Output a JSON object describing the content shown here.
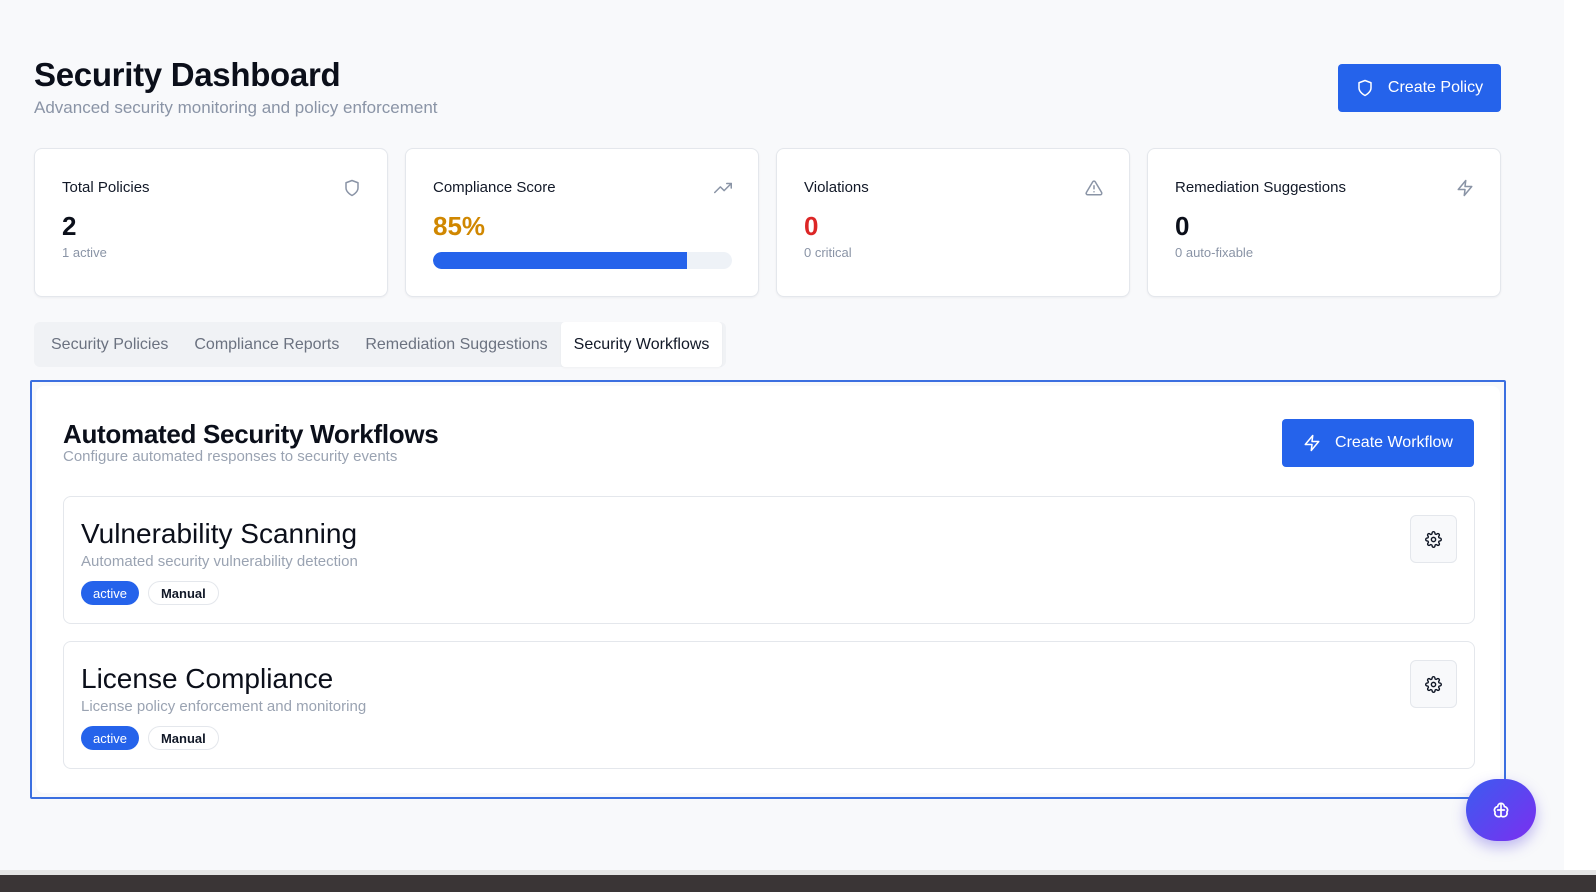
{
  "header": {
    "title": "Security Dashboard",
    "subtitle": "Advanced security monitoring and policy enforcement",
    "create_policy_label": "Create Policy"
  },
  "stats": [
    {
      "label": "Total Policies",
      "value": "2",
      "sub": "1 active",
      "icon": "shield-icon",
      "value_color": "#0b0f1a"
    },
    {
      "label": "Compliance Score",
      "value": "85%",
      "progress": 0.85,
      "icon": "trending-up-icon",
      "value_color": "#d08700"
    },
    {
      "label": "Violations",
      "value": "0",
      "sub": "0 critical",
      "icon": "alert-triangle-icon",
      "value_color": "#dc2626"
    },
    {
      "label": "Remediation Suggestions",
      "value": "0",
      "sub": "0 auto-fixable",
      "icon": "zap-icon",
      "value_color": "#0b0f1a"
    }
  ],
  "tabs": [
    {
      "label": "Security Policies",
      "active": false
    },
    {
      "label": "Compliance Reports",
      "active": false
    },
    {
      "label": "Remediation Suggestions",
      "active": false
    },
    {
      "label": "Security Workflows",
      "active": true
    }
  ],
  "panel": {
    "title": "Automated Security Workflows",
    "subtitle": "Configure automated responses to security events",
    "create_workflow_label": "Create Workflow"
  },
  "workflows": [
    {
      "name": "Vulnerability Scanning",
      "description": "Automated security vulnerability detection",
      "status": "active",
      "trigger": "Manual"
    },
    {
      "name": "License Compliance",
      "description": "License policy enforcement and monitoring",
      "status": "active",
      "trigger": "Manual"
    }
  ],
  "colors": {
    "accent": "#2563eb",
    "warning": "#d08700",
    "danger": "#dc2626",
    "fab_gradient": [
      "#3b5cf0",
      "#7b2ff0"
    ]
  },
  "fab": {
    "icon": "brain-icon"
  }
}
